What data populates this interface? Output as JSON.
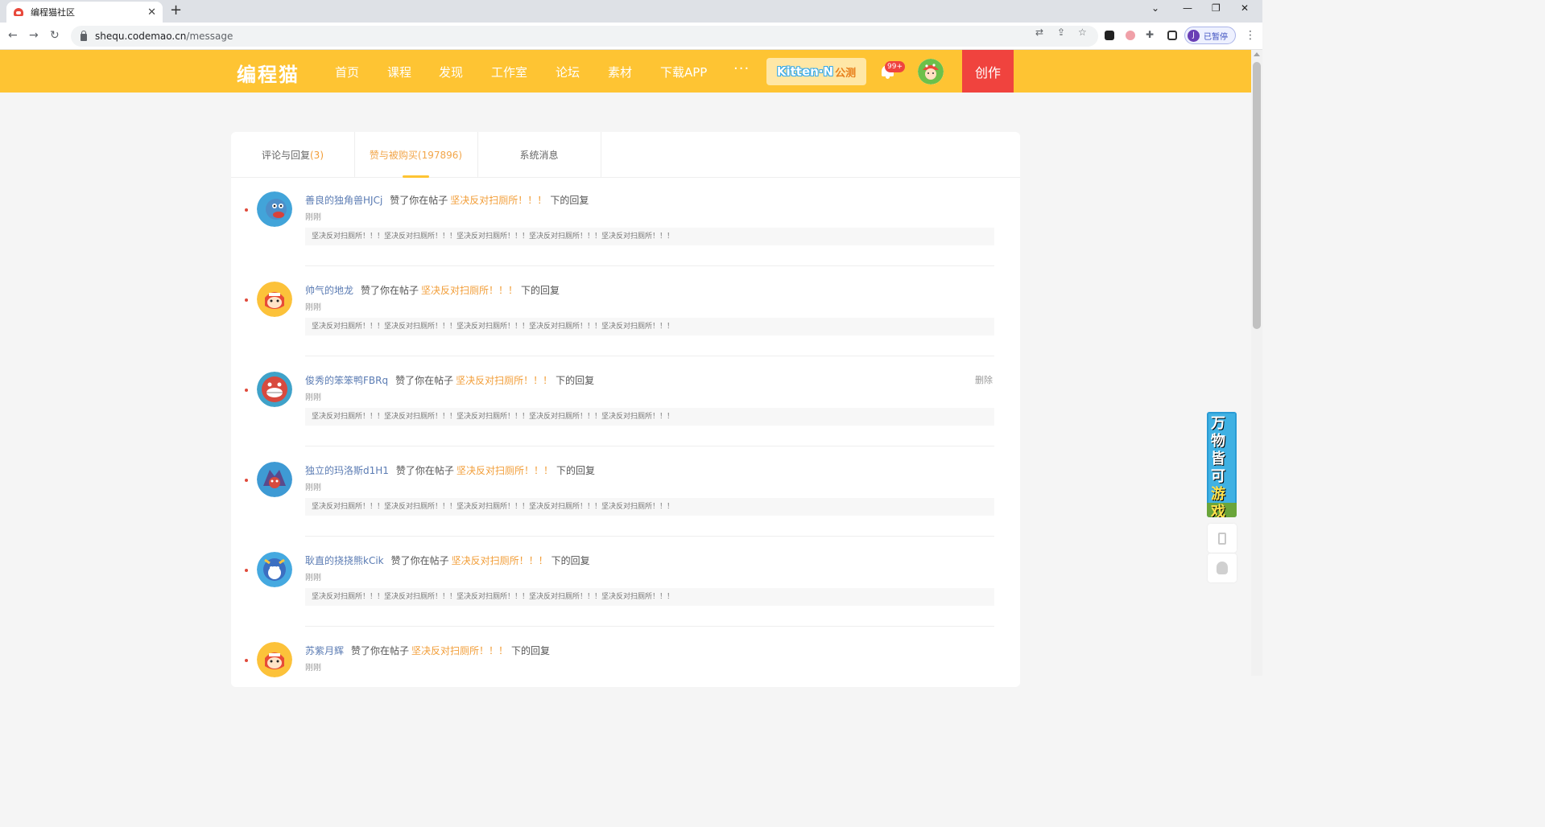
{
  "browser": {
    "tab_title": "编程猫社区",
    "url_host": "shequ.codemao.cn",
    "url_path": "/message",
    "profile_initial": "J",
    "profile_label": "已暂停"
  },
  "header": {
    "logo": "编程猫",
    "nav": [
      "首页",
      "课程",
      "发现",
      "工作室",
      "论坛",
      "素材",
      "下载APP"
    ],
    "more": "···",
    "kitten": "Kitten·N",
    "kitten_sub": "公测",
    "badge": "99+",
    "create_label": "创作",
    "brand_color": "#fec433",
    "accent_color": "#f0433e"
  },
  "tabs": [
    {
      "label": "评论与回复",
      "count": "(3)"
    },
    {
      "label": "赞与被购买",
      "count": "(197896)"
    },
    {
      "label": "系统消息",
      "count": ""
    }
  ],
  "messages": [
    {
      "user": "善良的独角兽HJCj",
      "action": "赞了你在帖子",
      "post": "坚决反对扫厕所！！！",
      "suffix": "下的回复",
      "time": "刚刚",
      "quote": "坚决反对扫厕所！！！坚决反对扫厕所！！！坚决反对扫厕所！！！坚决反对扫厕所！！！坚决反对扫厕所！！！"
    },
    {
      "user": "帅气的地龙",
      "action": "赞了你在帖子",
      "post": "坚决反对扫厕所！！！",
      "suffix": "下的回复",
      "time": "刚刚",
      "quote": "坚决反对扫厕所！！！坚决反对扫厕所！！！坚决反对扫厕所！！！坚决反对扫厕所！！！坚决反对扫厕所！！！"
    },
    {
      "user": "俊秀的笨笨鸭FBRq",
      "action": "赞了你在帖子",
      "post": "坚决反对扫厕所！！！",
      "suffix": "下的回复",
      "time": "刚刚",
      "quote": "坚决反对扫厕所！！！坚决反对扫厕所！！！坚决反对扫厕所！！！坚决反对扫厕所！！！坚决反对扫厕所！！！",
      "delete": "删除"
    },
    {
      "user": "独立的玛洛斯d1H1",
      "action": "赞了你在帖子",
      "post": "坚决反对扫厕所！！！",
      "suffix": "下的回复",
      "time": "刚刚",
      "quote": "坚决反对扫厕所！！！坚决反对扫厕所！！！坚决反对扫厕所！！！坚决反对扫厕所！！！坚决反对扫厕所！！！"
    },
    {
      "user": "耿直的挠挠熊kCik",
      "action": "赞了你在帖子",
      "post": "坚决反对扫厕所！！！",
      "suffix": "下的回复",
      "time": "刚刚",
      "quote": "坚决反对扫厕所！！！坚决反对扫厕所！！！坚决反对扫厕所！！！坚决反对扫厕所！！！坚决反对扫厕所！！！"
    },
    {
      "user": "苏紫月辉",
      "action": "赞了你在帖子",
      "post": "坚决反对扫厕所！！！",
      "suffix": "下的回复",
      "time": "刚刚",
      "quote": ""
    }
  ],
  "promo": {
    "line1": "万物皆可",
    "line2": "游戏"
  }
}
